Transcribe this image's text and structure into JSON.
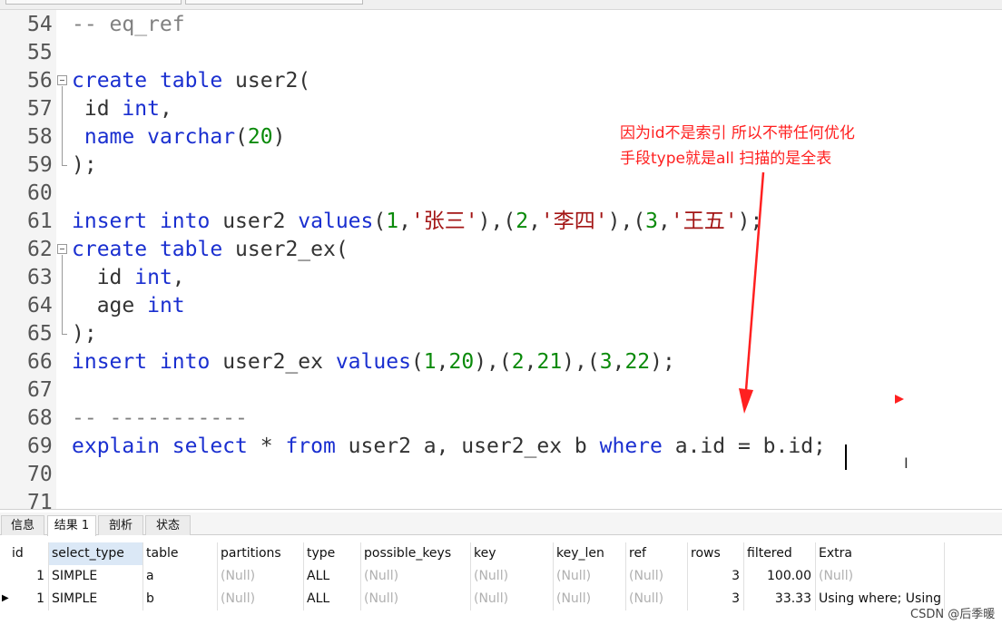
{
  "editor": {
    "lines": [
      {
        "n": "54",
        "tokens": [
          {
            "t": "-- eq_ref",
            "c": "cmt"
          }
        ]
      },
      {
        "n": "55",
        "tokens": []
      },
      {
        "n": "56",
        "tokens": [
          {
            "t": "create",
            "c": "kw"
          },
          {
            "t": " "
          },
          {
            "t": "table",
            "c": "kw"
          },
          {
            "t": " user2("
          }
        ]
      },
      {
        "n": "57",
        "tokens": [
          {
            "t": " id "
          },
          {
            "t": "int",
            "c": "kw"
          },
          {
            "t": ","
          }
        ]
      },
      {
        "n": "58",
        "tokens": [
          {
            "t": " "
          },
          {
            "t": "name",
            "c": "kw"
          },
          {
            "t": " "
          },
          {
            "t": "varchar",
            "c": "kw"
          },
          {
            "t": "("
          },
          {
            "t": "20",
            "c": "num"
          },
          {
            "t": ")"
          }
        ]
      },
      {
        "n": "59",
        "tokens": [
          {
            "t": ");"
          }
        ]
      },
      {
        "n": "60",
        "tokens": []
      },
      {
        "n": "61",
        "tokens": [
          {
            "t": "insert",
            "c": "kw"
          },
          {
            "t": " "
          },
          {
            "t": "into",
            "c": "kw"
          },
          {
            "t": " user2 "
          },
          {
            "t": "values",
            "c": "kw"
          },
          {
            "t": "("
          },
          {
            "t": "1",
            "c": "num"
          },
          {
            "t": ","
          },
          {
            "t": "'张三'",
            "c": "str"
          },
          {
            "t": "),("
          },
          {
            "t": "2",
            "c": "num"
          },
          {
            "t": ","
          },
          {
            "t": "'李四'",
            "c": "str"
          },
          {
            "t": "),("
          },
          {
            "t": "3",
            "c": "num"
          },
          {
            "t": ","
          },
          {
            "t": "'王五'",
            "c": "str"
          },
          {
            "t": ");"
          }
        ]
      },
      {
        "n": "62",
        "tokens": [
          {
            "t": "create",
            "c": "kw"
          },
          {
            "t": " "
          },
          {
            "t": "table",
            "c": "kw"
          },
          {
            "t": " user2_ex("
          }
        ]
      },
      {
        "n": "63",
        "tokens": [
          {
            "t": "  id "
          },
          {
            "t": "int",
            "c": "kw"
          },
          {
            "t": ","
          }
        ]
      },
      {
        "n": "64",
        "tokens": [
          {
            "t": "  age "
          },
          {
            "t": "int",
            "c": "kw"
          }
        ]
      },
      {
        "n": "65",
        "tokens": [
          {
            "t": ");"
          }
        ]
      },
      {
        "n": "66",
        "tokens": [
          {
            "t": "insert",
            "c": "kw"
          },
          {
            "t": " "
          },
          {
            "t": "into",
            "c": "kw"
          },
          {
            "t": " user2_ex "
          },
          {
            "t": "values",
            "c": "kw"
          },
          {
            "t": "("
          },
          {
            "t": "1",
            "c": "num"
          },
          {
            "t": ","
          },
          {
            "t": "20",
            "c": "num"
          },
          {
            "t": "),("
          },
          {
            "t": "2",
            "c": "num"
          },
          {
            "t": ","
          },
          {
            "t": "21",
            "c": "num"
          },
          {
            "t": "),("
          },
          {
            "t": "3",
            "c": "num"
          },
          {
            "t": ","
          },
          {
            "t": "22",
            "c": "num"
          },
          {
            "t": ");"
          }
        ]
      },
      {
        "n": "67",
        "tokens": []
      },
      {
        "n": "68",
        "tokens": [
          {
            "t": "-- -----------",
            "c": "cmt"
          }
        ]
      },
      {
        "n": "69",
        "tokens": [
          {
            "t": "explain",
            "c": "kw"
          },
          {
            "t": " "
          },
          {
            "t": "select",
            "c": "kw"
          },
          {
            "t": " * "
          },
          {
            "t": "from",
            "c": "kw"
          },
          {
            "t": " user2 a, user2_ex b "
          },
          {
            "t": "where",
            "c": "kw"
          },
          {
            "t": " a.id = b.id;"
          }
        ]
      },
      {
        "n": "70",
        "tokens": []
      },
      {
        "n": "71",
        "tokens": []
      }
    ]
  },
  "annotation": {
    "line1": "因为id不是索引 所以不带任何优化",
    "line2": "手段type就是all 扫描的是全表"
  },
  "results": {
    "tabs": [
      "信息",
      "结果 1",
      "剖析",
      "状态"
    ],
    "active_tab": "结果 1",
    "columns": [
      "id",
      "select_type",
      "table",
      "partitions",
      "type",
      "possible_keys",
      "key",
      "key_len",
      "ref",
      "rows",
      "filtered",
      "Extra"
    ],
    "rows": [
      [
        "1",
        "SIMPLE",
        "a",
        "(Null)",
        "ALL",
        "(Null)",
        "(Null)",
        "(Null)",
        "(Null)",
        "3",
        "100.00",
        "(Null)"
      ],
      [
        "1",
        "SIMPLE",
        "b",
        "(Null)",
        "ALL",
        "(Null)",
        "(Null)",
        "(Null)",
        "(Null)",
        "3",
        "33.33",
        "Using where; Using join buffer (hash join)"
      ]
    ],
    "watermark": "CSDN @后季暖"
  },
  "colors": {
    "keyword": "#1a2fd0",
    "number": "#0a8a0a",
    "string": "#a31515",
    "comment": "#808080",
    "annotation": "#ff2020"
  }
}
